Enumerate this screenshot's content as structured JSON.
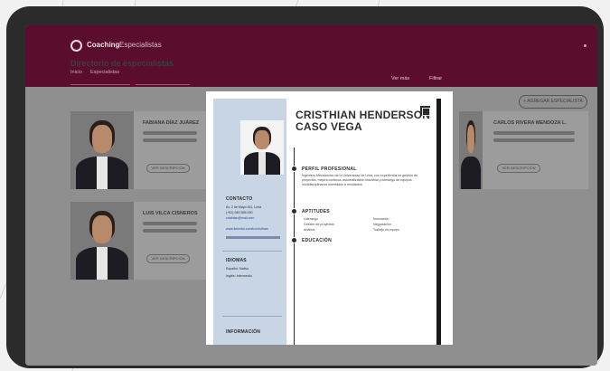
{
  "app": {
    "brand": "Coaching",
    "brand_sub": "Especialistas",
    "nav": [
      "Inicio",
      "Especialistas"
    ],
    "nav_right": [
      "Ver más",
      "Filtrar"
    ]
  },
  "page": {
    "title": "Directorio de especialistas",
    "create_button": "+ AGREGAR ESPECIALISTA"
  },
  "cards": [
    {
      "name": "FABIANA DÍAZ JUÁREZ",
      "button": "VER DESCRIPCIÓN"
    },
    {
      "name": "LUIS VILCA CISNEROS",
      "button": "VER DESCRIPCIÓN"
    },
    {
      "name": "CARLOS RIVERA MENDOZA L.",
      "button": "VER DESCRIPCIÓN"
    }
  ],
  "cv": {
    "name_line1": "CRISTHIAN HENDERSON",
    "name_line2": "CASO VEGA",
    "sidebar": {
      "contact_heading": "CONTACTO",
      "contact_lines": [
        "Av. 2 de Mayo 611, Lima",
        "(+51) 945 555 000",
        "cristhian@mail.com",
        "www.linkedin.com/in/cristhian"
      ],
      "languages_heading": "IDIOMAS",
      "languages": [
        "Español: Nativo",
        "Inglés: Intermedio"
      ],
      "more_heading": "INFORMACIÓN"
    },
    "sections": {
      "profile_heading": "PERFIL PROFESIONAL",
      "profile_text": "Ingeniero Mecatrónico de la Universidad de Lima, con experiencia en gestión de proyectos, mejora continua, automatización industrial y liderazgo de equipos multidisciplinarios orientados a resultados.",
      "skills_heading": "APTITUDES",
      "skills": [
        "Liderazgo",
        "Gestión de proyectos",
        "Análisis",
        "Innovación",
        "Negociación",
        "Trabajo en equipo"
      ],
      "education_heading": "EDUCACIÓN"
    }
  }
}
